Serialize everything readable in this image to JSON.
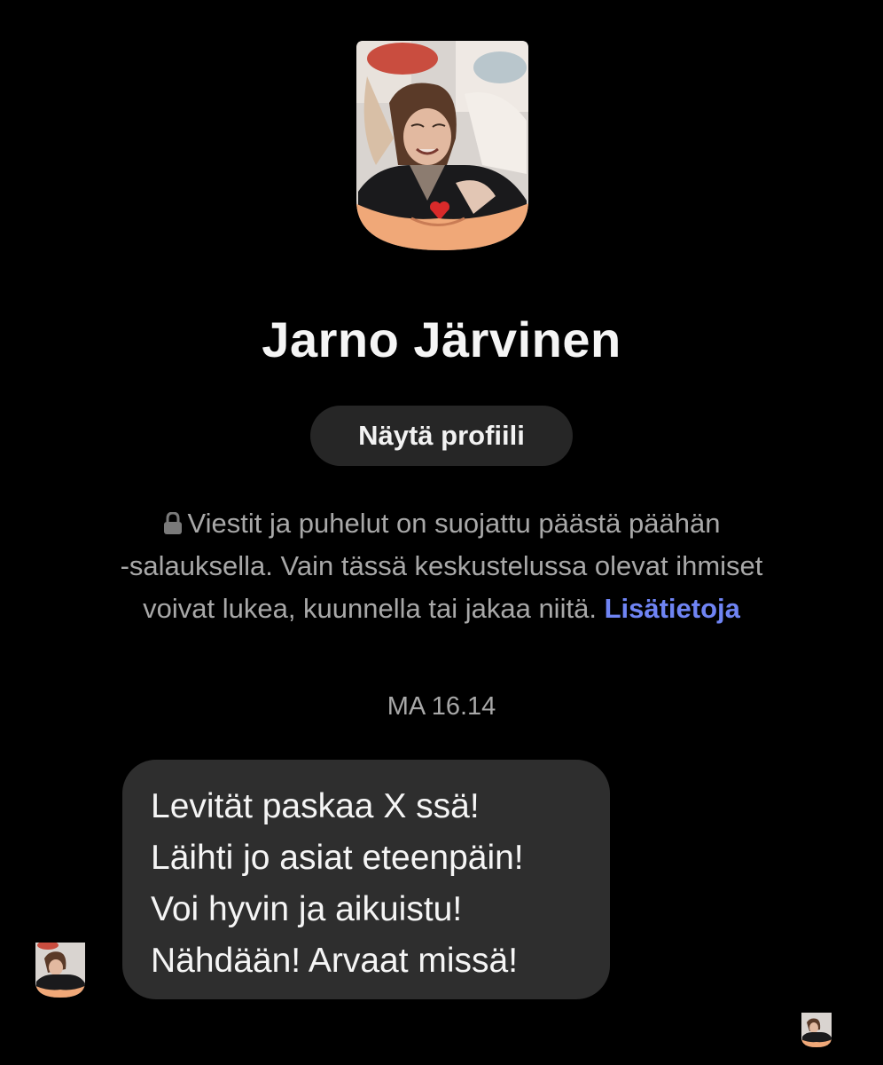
{
  "contact": {
    "name": "Jarno Järvinen",
    "view_profile_label": "Näytä profiili"
  },
  "encryption_notice": {
    "line1": "Viestit ja puhelut on suojattu päästä päähän",
    "line2": "-salauksella. Vain tässä keskustelussa olevat ihmiset",
    "line3": "voivat lukea, kuunnella tai jakaa niitä.",
    "link": "Lisätietoja"
  },
  "timestamp": "MA 16.14",
  "messages": [
    {
      "sender": "contact",
      "lines": [
        "Levität paskaa X ssä!",
        "Läihti jo asiat eteenpäin!",
        "Voi hyvin ja aikuistu!",
        "Nähdään! Arvaat missä!"
      ]
    }
  ],
  "icons": {
    "lock": "lock-icon",
    "avatar": "avatar",
    "seen": "seen-avatar"
  },
  "colors": {
    "background": "#000000",
    "bubble": "#2e2e2e",
    "button": "#262626",
    "link": "#6f84f4",
    "muted_text": "#a8a8a8"
  }
}
